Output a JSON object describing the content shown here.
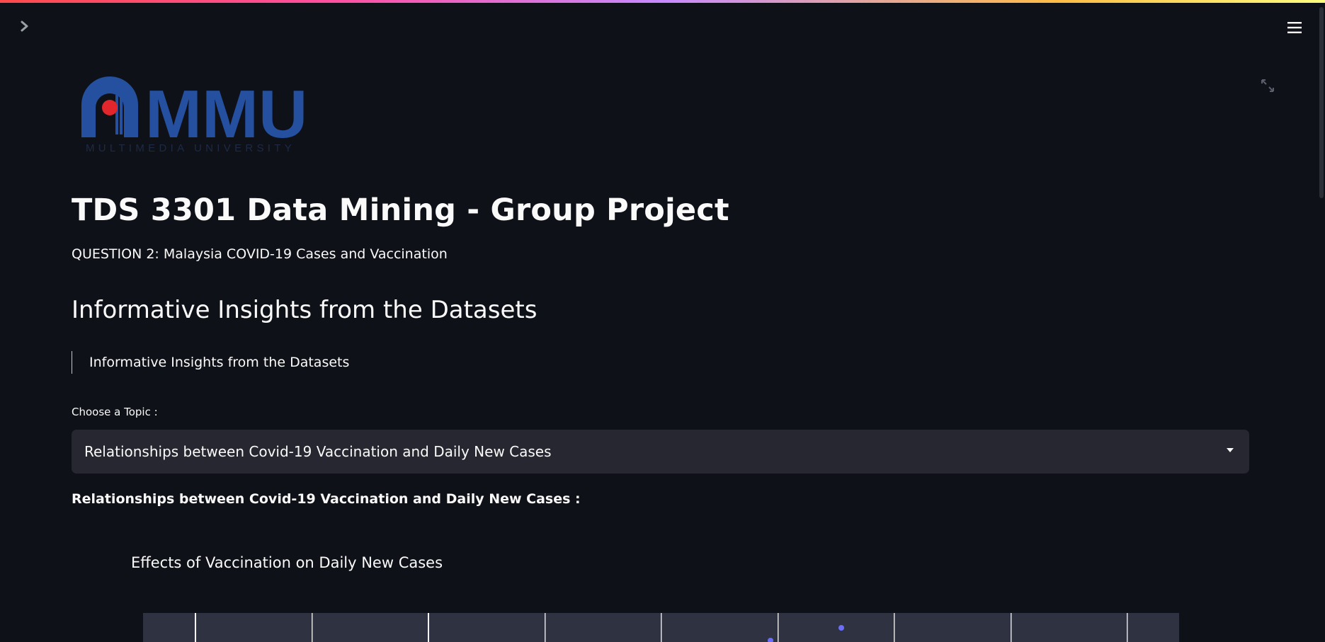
{
  "app": {
    "accent_gradient": [
      "#ff4b4b",
      "#ff4fa0",
      "#c78aff",
      "#ffbd45",
      "#fffd80"
    ],
    "background": "#0e1117"
  },
  "toolbar": {
    "sidebar_toggle_icon": "chevron-right-icon",
    "menu_icon": "hamburger-menu-icon"
  },
  "logo": {
    "text": "MMU",
    "tagline": "MULTIMEDIA UNIVERSITY",
    "colors": {
      "blue": "#2550a0",
      "red": "#e2262c"
    }
  },
  "header": {
    "title": "TDS 3301 Data Mining - Group Project",
    "subtitle": "QUESTION 2: Malaysia COVID-19 Cases and Vaccination"
  },
  "section": {
    "title": "Informative Insights from the Datasets",
    "blockquote": "Informative Insights from the Datasets"
  },
  "topic_select": {
    "label": "Choose a Topic :",
    "value": "Relationships between Covid-19 Vaccination and Daily New Cases"
  },
  "content": {
    "heading": "Relationships between Covid-19 Vaccination and Daily New Cases :",
    "chart_title": "Effects of Vaccination on Daily New Cases"
  },
  "chart_preview": {
    "background": "#2f3241",
    "point_color": "#6b6ef9"
  }
}
